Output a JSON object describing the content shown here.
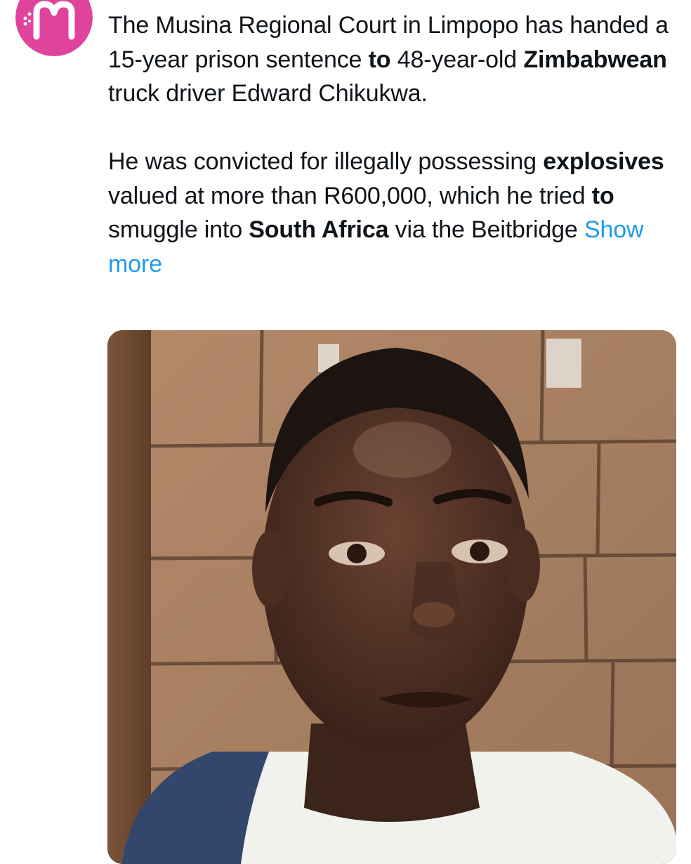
{
  "author": {
    "avatar_letter": "M",
    "avatar_color": "#e0439b",
    "avatar_icon": "brand-logo-m"
  },
  "tweet": {
    "paragraph1": {
      "t1": "The Musina Regional Court in Limpopo has handed a 15-year prison sentence ",
      "b1": "to",
      "t2": " 48-year-old ",
      "b2": "Zimbabwean",
      "t3": " truck driver Edward Chikukwa."
    },
    "paragraph2": {
      "t1": "He was convicted for illegally possessing ",
      "b1": "explosives",
      "t2": " valued at more than R600,000, which he tried ",
      "b2": "to",
      "t3": " smuggle into ",
      "b3": "South Africa",
      "t4": " via the Beitbridge "
    },
    "show_more": "Show more",
    "link_color": "#1d9bf0"
  },
  "media": {
    "icon": "photo-of-man-against-brick-wall"
  }
}
